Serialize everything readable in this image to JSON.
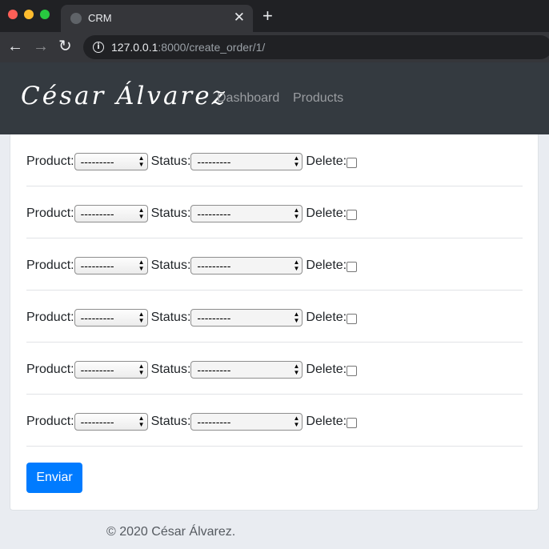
{
  "browser": {
    "tab_title": "CRM",
    "tab_close": "✕",
    "new_tab": "+",
    "url_host": "127.0.0.1",
    "url_rest": ":8000/create_order/1/",
    "back": "←",
    "forward": "→",
    "reload": "↻"
  },
  "navbar": {
    "brand": "César Álvarez",
    "links": [
      "Dashboard",
      "Products"
    ]
  },
  "form": {
    "rows": [
      {
        "product_label": "Product:",
        "product_value": "---------",
        "status_label": "Status:",
        "status_value": "---------",
        "delete_label": "Delete:"
      },
      {
        "product_label": "Product:",
        "product_value": "---------",
        "status_label": "Status:",
        "status_value": "---------",
        "delete_label": "Delete:"
      },
      {
        "product_label": "Product:",
        "product_value": "---------",
        "status_label": "Status:",
        "status_value": "---------",
        "delete_label": "Delete:"
      },
      {
        "product_label": "Product:",
        "product_value": "---------",
        "status_label": "Status:",
        "status_value": "---------",
        "delete_label": "Delete:"
      },
      {
        "product_label": "Product:",
        "product_value": "---------",
        "status_label": "Status:",
        "status_value": "---------",
        "delete_label": "Delete:"
      },
      {
        "product_label": "Product:",
        "product_value": "---------",
        "status_label": "Status:",
        "status_value": "---------",
        "delete_label": "Delete:"
      }
    ],
    "submit_label": "Enviar"
  },
  "footer": {
    "text": "© 2020 César Álvarez."
  },
  "colors": {
    "navbar_bg": "#343a40",
    "primary_button": "#007bff",
    "page_bg": "#e9ecf1"
  }
}
